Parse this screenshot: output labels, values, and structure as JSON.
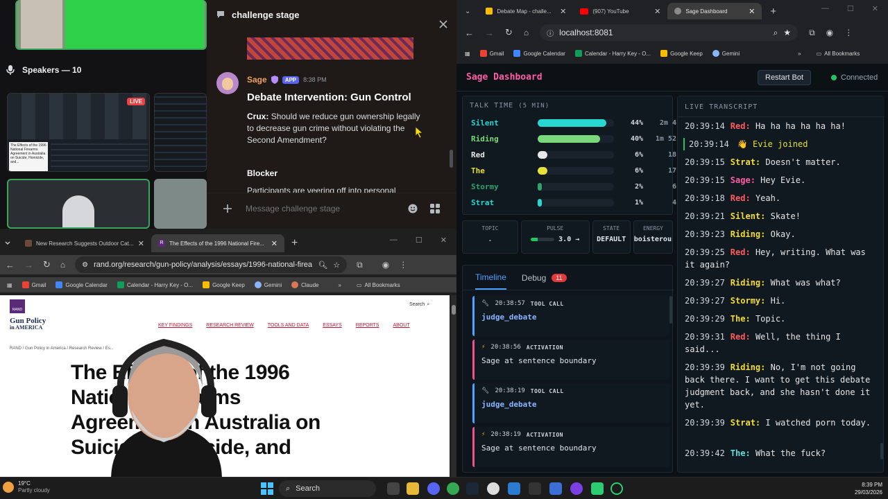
{
  "discord": {
    "channel_title": "challenge stage",
    "speakers_label": "Speakers — 10",
    "live_badge": "LIVE",
    "tile_text": "The Effects of the 1996 National Firearms Agreement in Australia on Suicide, Homicide, and...",
    "message": {
      "author": "Sage",
      "app_badge": "APP",
      "time": "8:38 PM",
      "title": "Debate Intervention: Gun Control",
      "crux_label": "Crux:",
      "crux_text": "Should we reduce gun ownership legally to decrease gun crime without violating the Second Amendment?",
      "blocker_label": "Blocker",
      "blocker_text": "Participants are veering off into personal"
    },
    "composer_placeholder": "Message challenge stage"
  },
  "chrome_left": {
    "tabs": [
      {
        "label": "New Research Suggests Outdoor Cat..."
      },
      {
        "label": "The Effects of the 1996 National Fire..."
      }
    ],
    "url": "rand.org/research/gun-policy/analysis/essays/1996-national-firea...",
    "bookmarks": [
      "Gmail",
      "Google Calendar",
      "Calendar - Harry Key - O...",
      "Google Keep",
      "Gemini",
      "Claude"
    ],
    "all_bookmarks": "All Bookmarks",
    "page": {
      "logo_badge": "RAND",
      "logo_line1": "Gun Policy",
      "logo_line2": "in AMERICA",
      "search": "Search",
      "nav": [
        "KEY FINDINGS",
        "RESEARCH REVIEW",
        "TOOLS AND DATA",
        "ESSAYS",
        "REPORTS",
        "ABOUT"
      ],
      "breadcrumb": "RAND  /  Gun Policy in America  /  Research Review  /  Es...",
      "headline_1": "The Effects of the 1996",
      "headline_2": "National Firearms",
      "headline_3": "Agreement in Australia on",
      "headline_4": "Suicide, Homicide, and"
    }
  },
  "chrome_right": {
    "tabs": [
      {
        "label": "Debate Map - challe..."
      },
      {
        "label": "(907) YouTube"
      },
      {
        "label": "Sage Dashboard"
      }
    ],
    "url": "localhost:8081",
    "bookmarks": [
      "Gmail",
      "Google Calendar",
      "Calendar - Harry Key - O...",
      "Google Keep",
      "Gemini"
    ],
    "all_bookmarks": "All Bookmarks"
  },
  "sage": {
    "title": "Sage Dashboard",
    "restart_label": "Restart Bot",
    "status": "Connected",
    "talk_time_title": "TALK TIME",
    "talk_time_window": "(5 MIN)",
    "speakers": [
      {
        "name": "Silent",
        "pct_label": "44%",
        "time": "2m 4s",
        "fraction": 0.44,
        "color": "#26d7d2"
      },
      {
        "name": "Riding",
        "pct_label": "40%",
        "time": "1m 52s",
        "fraction": 0.4,
        "color": "#7ad97a"
      },
      {
        "name": "Red",
        "pct_label": "6%",
        "time": "18s",
        "fraction": 0.06,
        "color": "#e8e8e8"
      },
      {
        "name": "The",
        "pct_label": "6%",
        "time": "17s",
        "fraction": 0.06,
        "color": "#e6e03a"
      },
      {
        "name": "Stormy",
        "pct_label": "2%",
        "time": "6s",
        "fraction": 0.02,
        "color": "#2fa36a"
      },
      {
        "name": "Strat",
        "pct_label": "1%",
        "time": "4s",
        "fraction": 0.01,
        "color": "#26d7d2"
      }
    ],
    "stats": {
      "topic_label": "TOPIC",
      "topic_value": "-",
      "pulse_label": "PULSE",
      "pulse_value": "3.0 →",
      "pulse_fraction": 0.3,
      "state_label": "STATE",
      "state_value": "DEFAULT",
      "energy_label": "ENERGY",
      "energy_value": "boisterous"
    },
    "tabs": {
      "timeline": "Timeline",
      "debug": "Debug",
      "debug_count": "11"
    },
    "timeline": [
      {
        "time": "20:38:57",
        "tag": "TOOL CALL",
        "body": "judge_debate",
        "kind": "tool"
      },
      {
        "time": "20:38:56",
        "tag": "ACTIVATION",
        "body": "Sage at sentence boundary",
        "kind": "activation"
      },
      {
        "time": "20:38:19",
        "tag": "TOOL CALL",
        "body": "judge_debate",
        "kind": "tool"
      },
      {
        "time": "20:38:19",
        "tag": "ACTIVATION",
        "body": "Sage at sentence boundary",
        "kind": "activation"
      }
    ],
    "transcript_title": "LIVE TRANSCRIPT",
    "transcript": [
      {
        "time": "20:39:14",
        "speaker": "Red:",
        "text": "Ha ha ha ha ha ha!",
        "color": "#ff5c5c"
      },
      {
        "time": "20:39:14",
        "speaker": "",
        "text": "👋 Evie joined",
        "color": "#e6e03a",
        "system": true
      },
      {
        "time": "20:39:15",
        "speaker": "Strat:",
        "text": "Doesn't matter.",
        "color": "#f3dd35"
      },
      {
        "time": "20:39:15",
        "speaker": "Sage:",
        "text": "Hey Evie.",
        "color": "#ff5ca8"
      },
      {
        "time": "20:39:18",
        "speaker": "Red:",
        "text": "Yeah.",
        "color": "#ff5c5c"
      },
      {
        "time": "20:39:21",
        "speaker": "Silent:",
        "text": "Skate!",
        "color": "#f3dd35"
      },
      {
        "time": "20:39:23",
        "speaker": "Riding:",
        "text": "Okay.",
        "color": "#f3dd35"
      },
      {
        "time": "20:39:25",
        "speaker": "Red:",
        "text": "Hey, writing. What was it again?",
        "color": "#ff5c5c"
      },
      {
        "time": "20:39:27",
        "speaker": "Riding:",
        "text": "What was what?",
        "color": "#f3dd35"
      },
      {
        "time": "20:39:27",
        "speaker": "Stormy:",
        "text": "Hi.",
        "color": "#f3dd35"
      },
      {
        "time": "20:39:29",
        "speaker": "The:",
        "text": "Topic.",
        "color": "#f3dd35"
      },
      {
        "time": "20:39:31",
        "speaker": "Red:",
        "text": "Well, the thing I said...",
        "color": "#ff5c5c"
      },
      {
        "time": "20:39:39",
        "speaker": "Riding:",
        "text": "No, I'm not going back there. I want to get this debate judgment back, and she hasn't done it yet.",
        "color": "#f3dd35"
      },
      {
        "time": "20:39:39",
        "speaker": "Strat:",
        "text": "I watched porn today.",
        "color": "#f3dd35"
      },
      {
        "time": "20:39:42",
        "speaker": "The:",
        "text": "What the fuck?",
        "color": "#5ce0e0"
      }
    ]
  },
  "taskbar": {
    "weather_temp": "19°C",
    "weather_desc": "Partly cloudy",
    "search": "Search",
    "time": "8:39 PM",
    "date": "29/03/2026"
  }
}
